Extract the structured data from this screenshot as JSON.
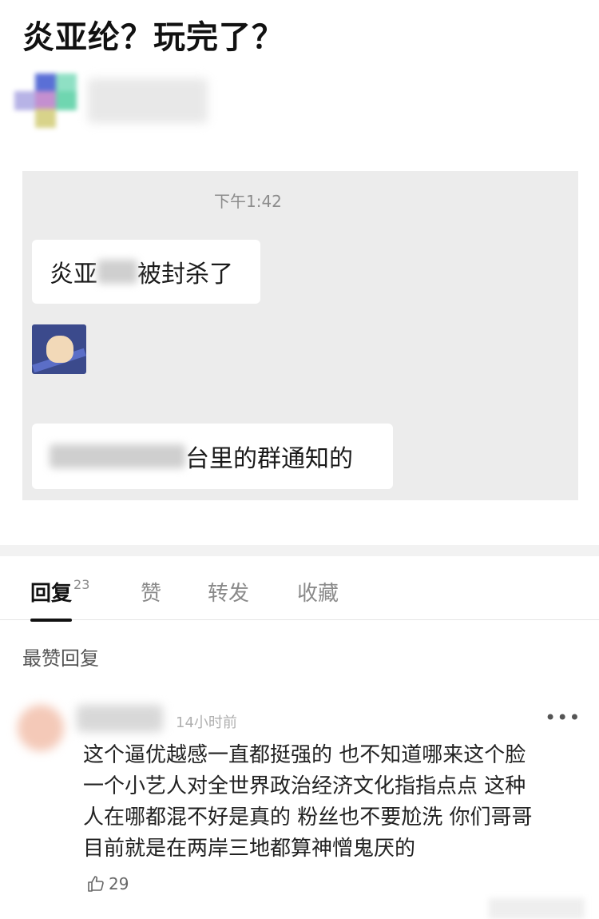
{
  "post": {
    "title": "炎亚纶？玩完了？"
  },
  "chat": {
    "time": "下午1:42",
    "bubble_1_before": "炎亚",
    "bubble_1_after": "被封杀了",
    "bubble_2_after": "台里的群通知的",
    "sticker": "cat-sticker"
  },
  "tabs": [
    {
      "label": "回复",
      "count": "23"
    },
    {
      "label": "赞"
    },
    {
      "label": "转发"
    },
    {
      "label": "收藏"
    }
  ],
  "section_label": "最赞回复",
  "comment": {
    "time": "14小时前",
    "more": "•••",
    "text_lines": [
      "这个逼优越感一直都挺强的 也不知道哪来这个脸",
      "一个小艺人对全世界政治经济文化指指点点 这种",
      "人在哪都混不好是真的 粉丝也不要尬洗 你们哥哥",
      "目前就是在两岸三地都算神憎鬼厌的"
    ],
    "likes": "29"
  }
}
